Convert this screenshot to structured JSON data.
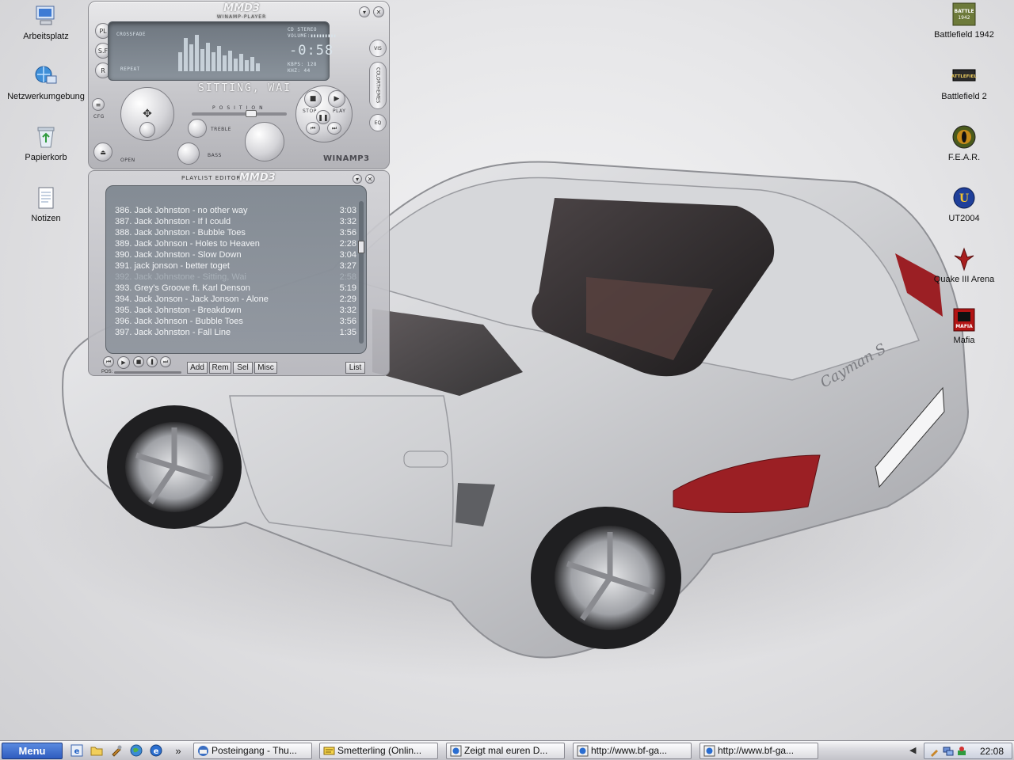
{
  "desktop_left": [
    {
      "label": "Arbeitsplatz",
      "icon": "my-computer-icon"
    },
    {
      "label": "Netzwerkumgebung",
      "icon": "network-icon"
    },
    {
      "label": "Papierkorb",
      "icon": "recycle-bin-icon"
    },
    {
      "label": "Notizen",
      "icon": "notepad-icon"
    }
  ],
  "desktop_right": [
    {
      "label": "Battlefield 1942",
      "icon": "battlefield-1942-icon"
    },
    {
      "label": "Battlefield 2",
      "icon": "battlefield-2-icon"
    },
    {
      "label": "F.E.A.R.",
      "icon": "fear-icon"
    },
    {
      "label": "UT2004",
      "icon": "ut2004-icon"
    },
    {
      "label": "Quake III Arena",
      "icon": "quake3-icon"
    },
    {
      "label": "Mafia",
      "icon": "mafia-icon"
    }
  ],
  "player": {
    "brand": "MMD3",
    "subbrand": "WINAMP-PLAYER",
    "crossfade": "CROSSFADE",
    "repeat": "REPEAT",
    "stereo": "CD STEREO",
    "volume": "VOLUME:",
    "time": "-0:58",
    "kbps": "KBPS: 128",
    "khz": "KHZ: 44",
    "song_ticker": "SITTING, WAI",
    "position": "POSITION",
    "treble": "TREBLE",
    "bass": "BASS",
    "stop": "STOP",
    "play": "PLAY",
    "open": "OPEN",
    "cfg": "CFG",
    "vis": "VIS",
    "colorthemes": "COLORTHEMES",
    "eq": "EQ",
    "winamp": "WINAMP3",
    "side_buttons": [
      "PL",
      "S.F",
      "R"
    ]
  },
  "playlist": {
    "title": "PLAYLIST EDITOR",
    "brand": "MMD3",
    "tracks": [
      {
        "title": "386. Jack Johnston - no other way",
        "duration": "3:03",
        "current": false
      },
      {
        "title": "387. Jack Johnston - If I could",
        "duration": "3:32",
        "current": false
      },
      {
        "title": "388. Jack Johnston - Bubble Toes",
        "duration": "3:56",
        "current": false
      },
      {
        "title": "389. Jack Johnson - Holes to Heaven",
        "duration": "2:28",
        "current": false
      },
      {
        "title": "390. Jack Johnston - Slow Down",
        "duration": "3:04",
        "current": false
      },
      {
        "title": "391. jack jonson - better toget",
        "duration": "3:27",
        "current": false
      },
      {
        "title": "392. Jack Johnstone - Sitting, Wai",
        "duration": "2:58",
        "current": true
      },
      {
        "title": "393. Grey's Groove ft. Karl Denson",
        "duration": "5:19",
        "current": false
      },
      {
        "title": "394. Jack Jonson - Jack Jonson - Alone",
        "duration": "2:29",
        "current": false
      },
      {
        "title": "395. Jack Johnston - Breakdown",
        "duration": "3:32",
        "current": false
      },
      {
        "title": "396. Jack Johnson - Bubble Toes",
        "duration": "3:56",
        "current": false
      },
      {
        "title": "397. Jack Johnston - Fall Line",
        "duration": "1:35",
        "current": false
      }
    ],
    "buttons": {
      "add": "Add",
      "rem": "Rem",
      "sel": "Sel",
      "misc": "Misc",
      "list": "List"
    },
    "pos_label": "POS:"
  },
  "taskbar": {
    "menu": "Menu",
    "quicklaunch_more": "»",
    "tasks": [
      {
        "label": "Posteingang - Thu...",
        "icon": "thunderbird-icon"
      },
      {
        "label": "Smetterling (Onlin...",
        "icon": "messenger-icon"
      },
      {
        "label": "Zeigt mal euren D...",
        "icon": "browser-icon"
      },
      {
        "label": "http://www.bf-ga...",
        "icon": "browser-icon"
      },
      {
        "label": "http://www.bf-ga...",
        "icon": "browser-icon"
      }
    ],
    "clock": "22:08"
  },
  "colors": {
    "taskbar_start": "#2f5cbf",
    "car_silver": "#c8c9cc",
    "lcd": "#7a838c"
  }
}
